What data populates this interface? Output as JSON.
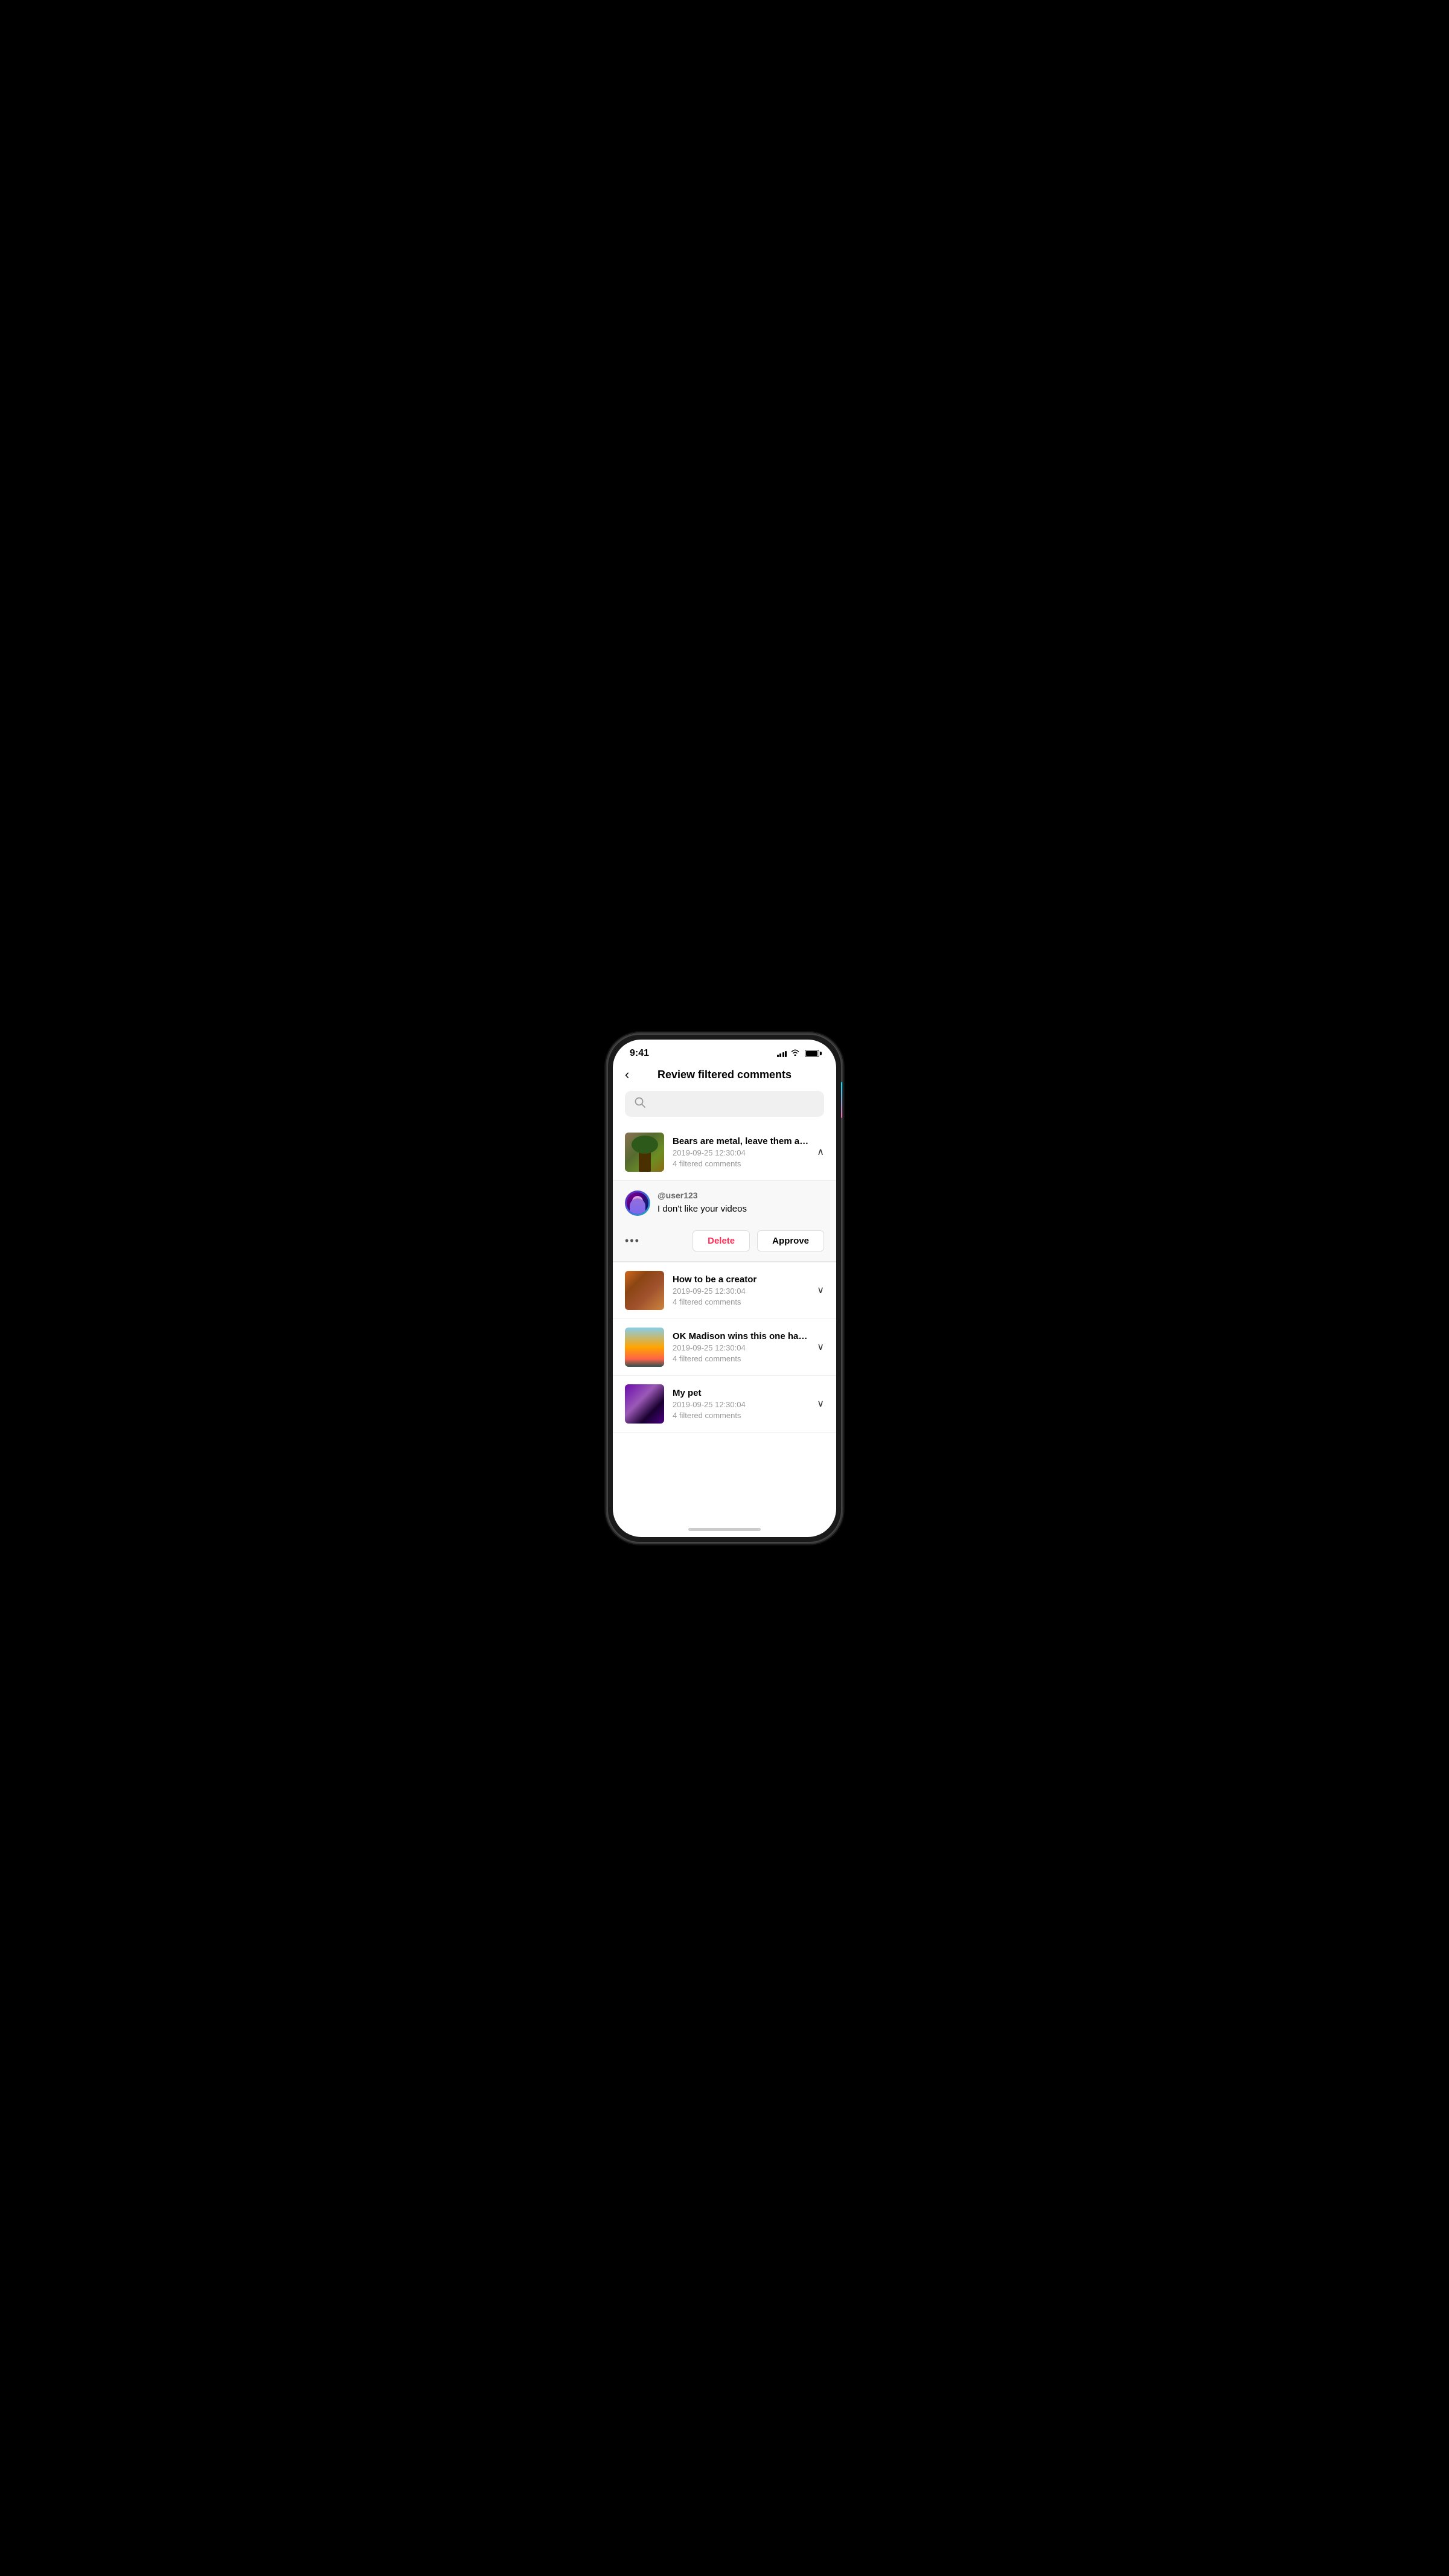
{
  "status_bar": {
    "time": "9:41",
    "signal_bars": [
      4,
      6,
      8,
      10,
      12
    ],
    "wifi": "wifi",
    "battery": "battery"
  },
  "header": {
    "back_label": "‹",
    "title": "Review filtered comments"
  },
  "search": {
    "placeholder": "",
    "icon": "🔍"
  },
  "videos": [
    {
      "id": "v1",
      "title": "Bears are metal, leave them alone",
      "date": "2019-09-25 12:30:04",
      "filter_count": "4 filtered comments",
      "thumb_class": "thumb-bears",
      "expanded": true,
      "chevron": "∧",
      "comments": [
        {
          "username": "@user123",
          "text": "I don't like your videos",
          "avatar": "user123"
        }
      ],
      "actions": {
        "more": "•••",
        "delete": "Delete",
        "approve": "Approve"
      }
    },
    {
      "id": "v2",
      "title": "How to be a creator",
      "date": "2019-09-25 12:30:04",
      "filter_count": "4 filtered comments",
      "thumb_class": "thumb-creator",
      "expanded": false,
      "chevron": "∨"
    },
    {
      "id": "v3",
      "title": "OK Madison wins this one hahaha...",
      "date": "2019-09-25 12:30:04",
      "filter_count": "4 filtered comments",
      "thumb_class": "thumb-madison",
      "expanded": false,
      "chevron": "∨"
    },
    {
      "id": "v4",
      "title": "My pet",
      "date": "2019-09-25 12:30:04",
      "filter_count": "4 filtered comments",
      "thumb_class": "thumb-pet",
      "expanded": false,
      "chevron": "∨"
    }
  ]
}
